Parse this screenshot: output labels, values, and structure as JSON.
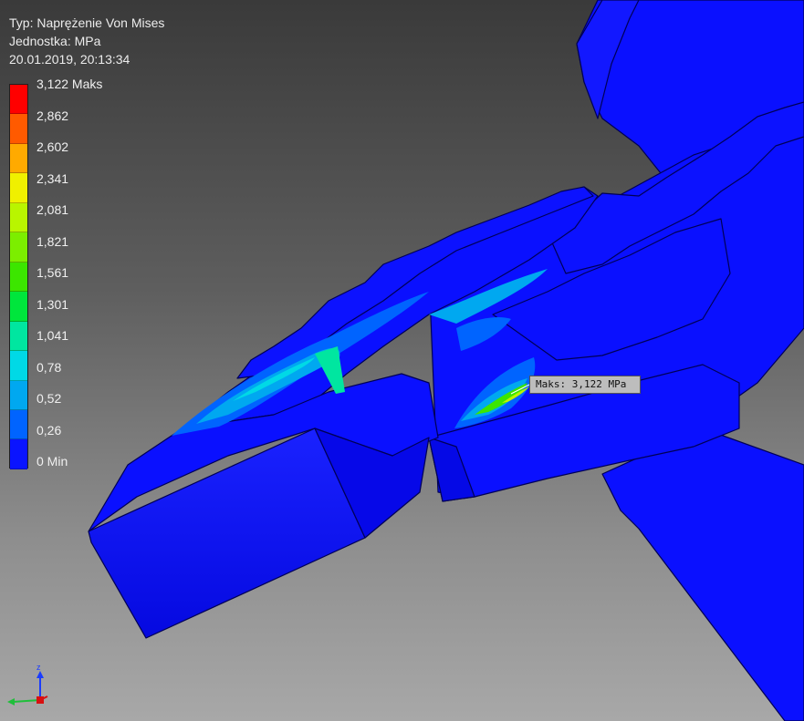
{
  "header": {
    "type_line": "Typ: Naprężenie Von Mises",
    "unit_line": "Jednostka: MPa",
    "timestamp_line": "20.01.2019, 20:13:34"
  },
  "legend": {
    "labels": [
      "3,122 Maks",
      "2,862",
      "2,602",
      "2,341",
      "2,081",
      "1,821",
      "1,561",
      "1,301",
      "1,041",
      "0,78",
      "0,52",
      "0,26",
      "0 Min"
    ],
    "colors": [
      "#ff0000",
      "#ff5a00",
      "#ffaa00",
      "#f0f000",
      "#b9f500",
      "#7cee00",
      "#3ce600",
      "#00e63c",
      "#00e6a0",
      "#00d9e6",
      "#00a8f0",
      "#0064ff",
      "#0a14ff"
    ]
  },
  "probe": {
    "label": "Maks: 3,122 MPa"
  },
  "model_colors": {
    "base": "#0a10ff",
    "edge": "#000066"
  },
  "triad_icons": [
    "z-axis-icon",
    "x-axis-icon",
    "y-axis-icon"
  ]
}
